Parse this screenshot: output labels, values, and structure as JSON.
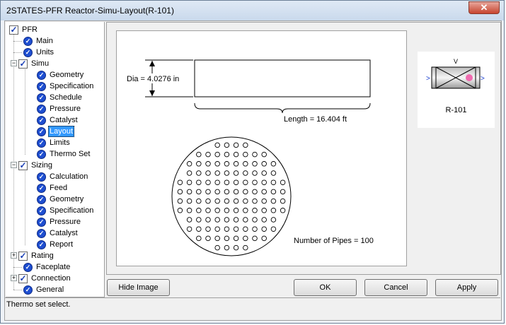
{
  "window": {
    "title": "2STATES-PFR Reactor-Simu-Layout(R-101)",
    "close_label": "✕"
  },
  "tree": {
    "root": "PFR",
    "items": [
      {
        "label": "Main"
      },
      {
        "label": "Units"
      },
      {
        "label": "Simu"
      },
      {
        "label": "Geometry"
      },
      {
        "label": "Specification"
      },
      {
        "label": "Schedule"
      },
      {
        "label": "Pressure"
      },
      {
        "label": "Catalyst"
      },
      {
        "label": "Layout",
        "selected": true
      },
      {
        "label": "Limits"
      },
      {
        "label": "Thermo Set"
      },
      {
        "label": "Sizing"
      },
      {
        "label": "Calculation"
      },
      {
        "label": "Feed"
      },
      {
        "label": "Geometry"
      },
      {
        "label": "Specification"
      },
      {
        "label": "Pressure"
      },
      {
        "label": "Catalyst"
      },
      {
        "label": "Report"
      },
      {
        "label": "Rating"
      },
      {
        "label": "Faceplate"
      },
      {
        "label": "Connection"
      },
      {
        "label": "General"
      }
    ]
  },
  "drawing": {
    "dia_label": "Dia = 4.0276 in",
    "length_label": "Length = 16.404 ft",
    "pipes_label": "Number of Pipes = 100"
  },
  "equipment": {
    "label": "R-101",
    "top_mark": "V"
  },
  "buttons": {
    "hide_image": "Hide Image",
    "ok": "OK",
    "cancel": "Cancel",
    "apply": "Apply"
  },
  "status": {
    "text": "Thermo set select."
  },
  "colors": {
    "selection": "#3399ff",
    "node_icon": "#1f4fd1",
    "check": "#1a3fb5"
  }
}
